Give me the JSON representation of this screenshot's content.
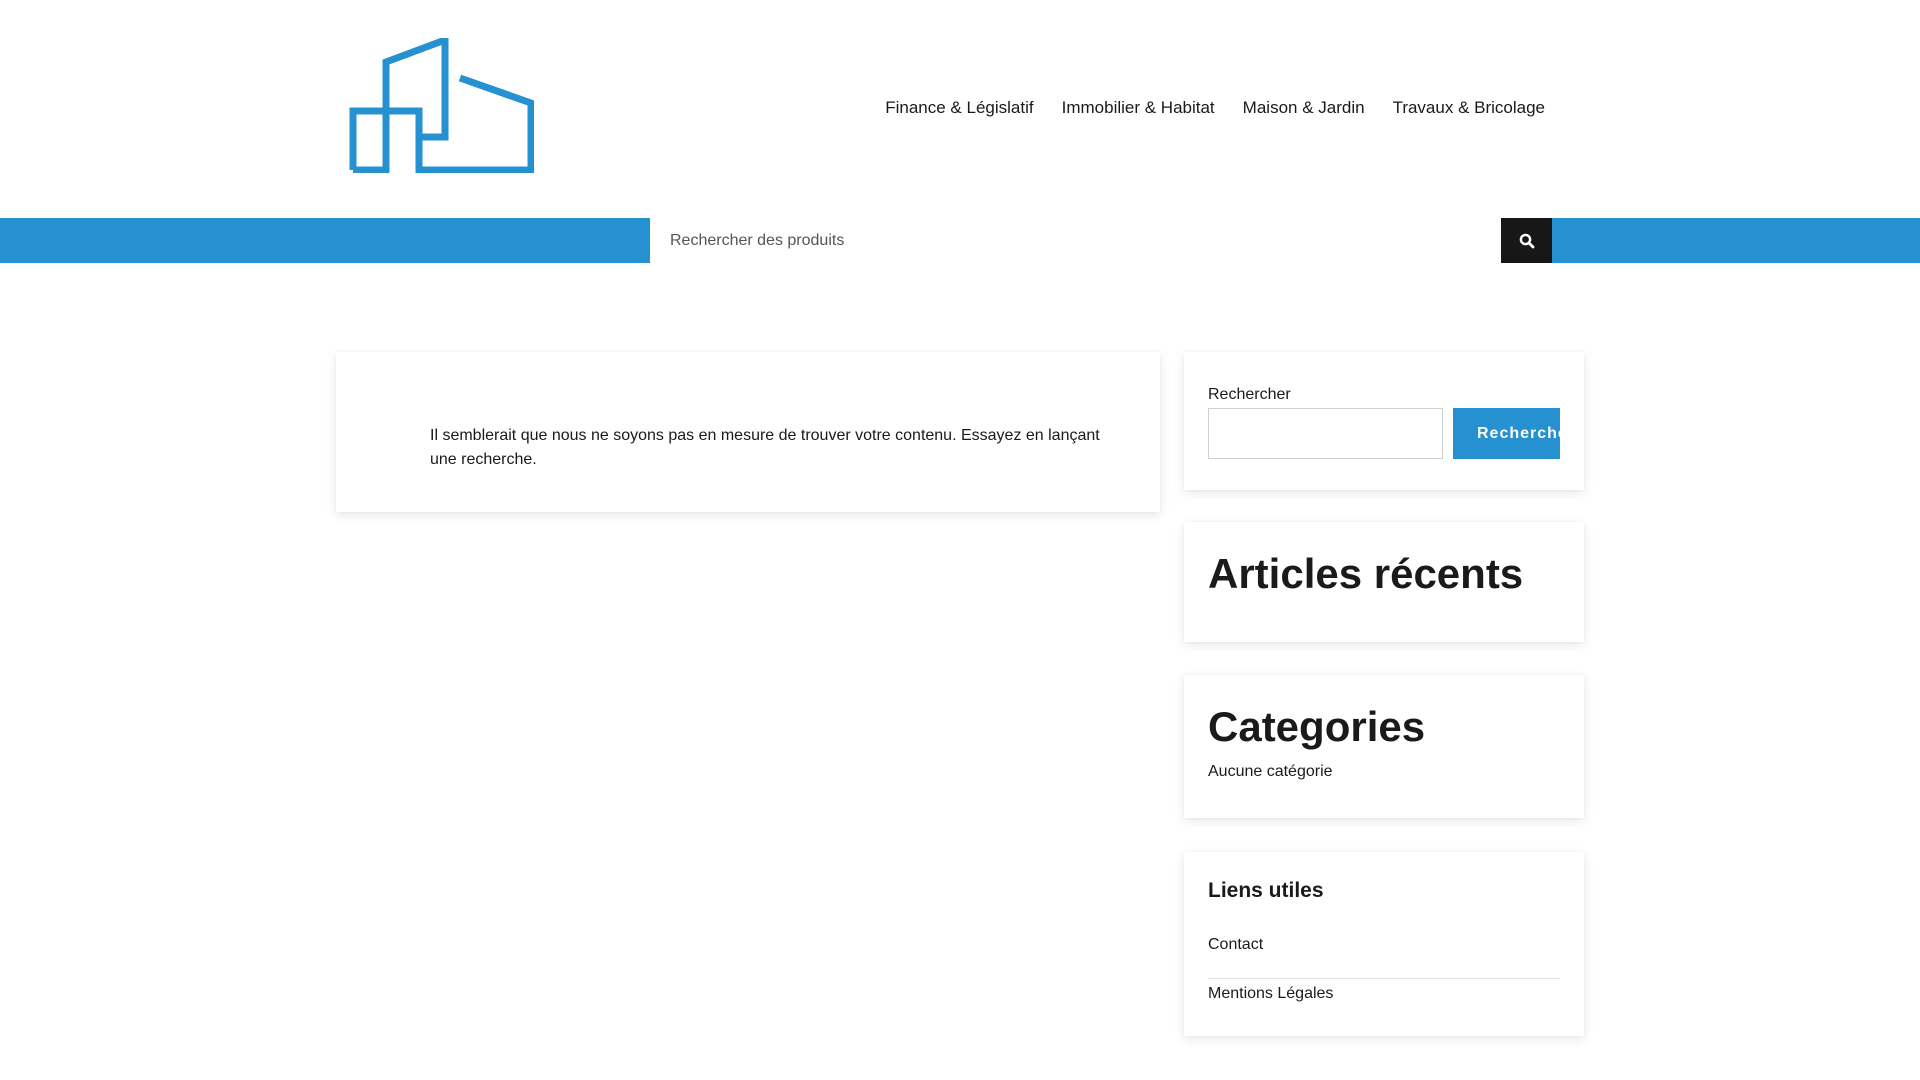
{
  "brand": {
    "accent": "#2591d0",
    "dark": "#171717",
    "logo_icon": "building-logo-icon"
  },
  "nav": {
    "items": [
      {
        "label": "Finance & Législatif"
      },
      {
        "label": "Immobilier & Habitat"
      },
      {
        "label": "Maison & Jardin"
      },
      {
        "label": "Travaux & Bricolage"
      }
    ]
  },
  "product_search": {
    "placeholder": "Rechercher des produits",
    "button_icon": "search-icon"
  },
  "main": {
    "message": "Il semblerait que nous ne soyons pas en mesure de trouver votre contenu. Essayez en lançant une recherche."
  },
  "sidebar": {
    "search": {
      "label": "Rechercher",
      "value": "",
      "button_label": "Recherche"
    },
    "recent_articles": {
      "title": "Articles récents"
    },
    "categories": {
      "title": "Categories",
      "empty_text": "Aucune catégorie"
    },
    "useful_links": {
      "title": "Liens utiles",
      "items": [
        {
          "label": "Contact"
        },
        {
          "label": "Mentions Légales"
        }
      ]
    }
  }
}
